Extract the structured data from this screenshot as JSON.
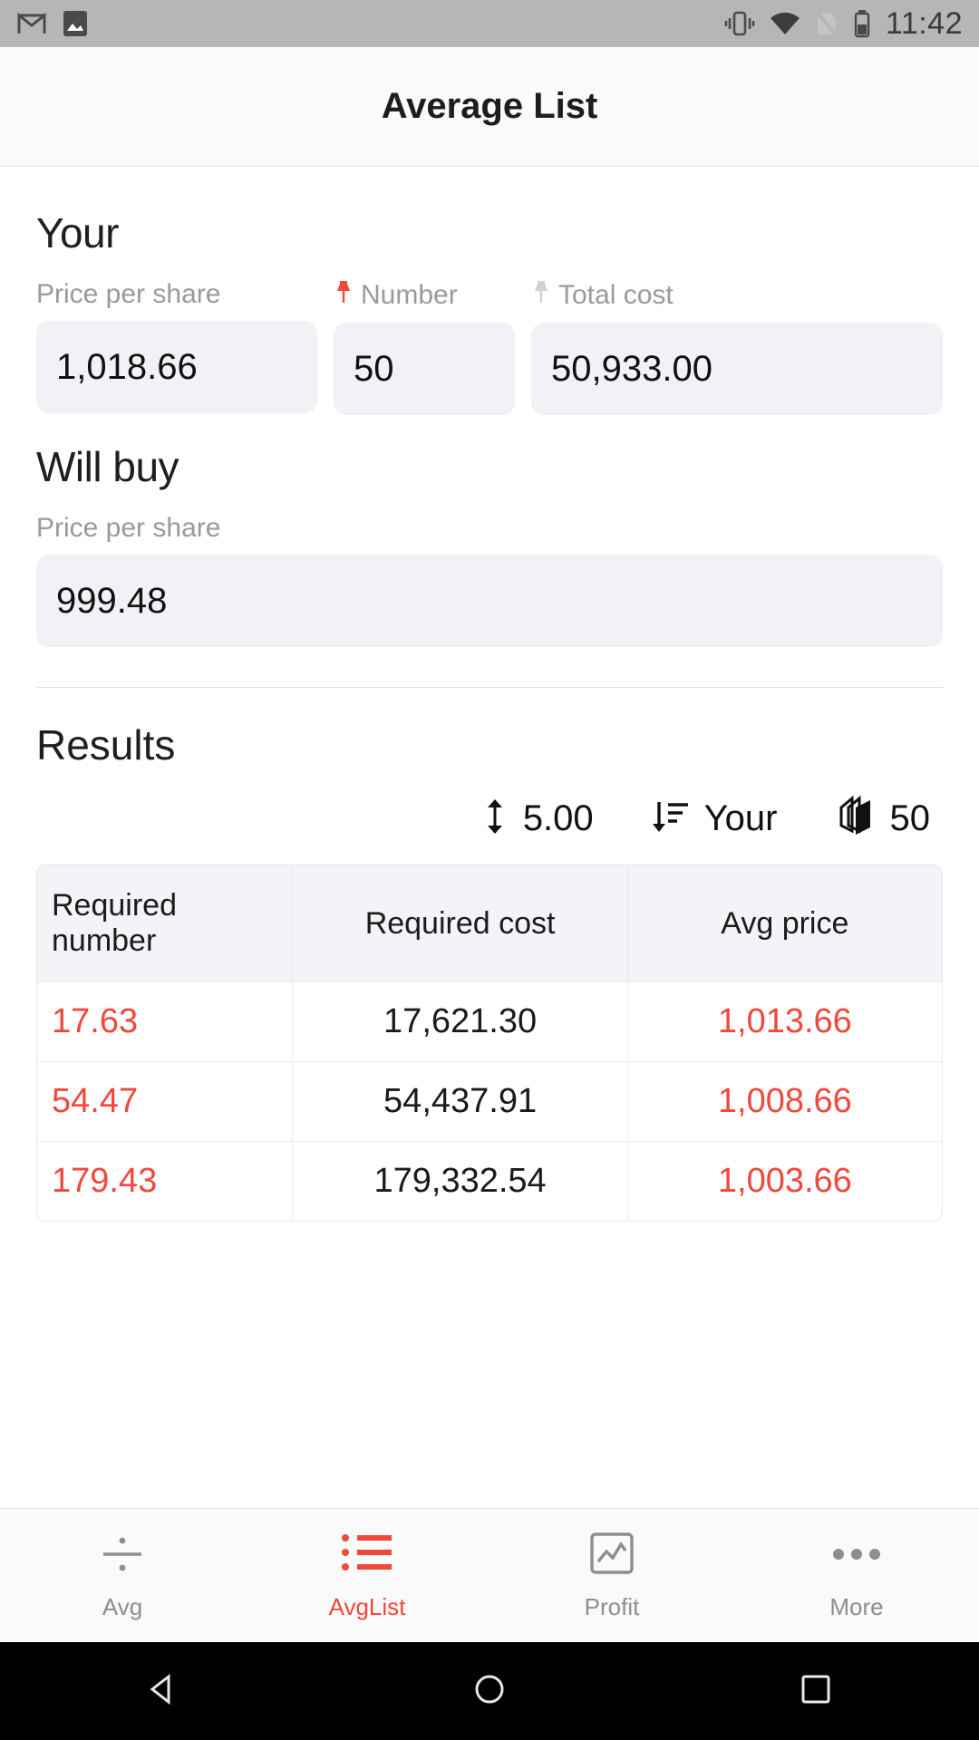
{
  "status_bar": {
    "time": "11:42",
    "left_icons": [
      "gmail-icon",
      "gallery-icon"
    ],
    "right_icons": [
      "vibrate-icon",
      "wifi-icon",
      "sim-missing-icon",
      "battery-icon"
    ]
  },
  "app_bar": {
    "title": "Average List"
  },
  "your_section": {
    "heading": "Your",
    "fields": [
      {
        "label": "Price per share",
        "value": "1,018.66",
        "pin": "none"
      },
      {
        "label": "Number",
        "value": "50",
        "pin": "red"
      },
      {
        "label": "Total cost",
        "value": "50,933.00",
        "pin": "gray"
      }
    ]
  },
  "will_buy_section": {
    "heading": "Will buy",
    "label": "Price per share",
    "value": "999.48"
  },
  "results_section": {
    "heading": "Results",
    "toolbar": [
      {
        "icon": "step-updown-icon",
        "value": "5.00"
      },
      {
        "icon": "sort-descending-icon",
        "value": "Your"
      },
      {
        "icon": "layers-stack-icon",
        "value": "50"
      }
    ],
    "table": {
      "headers": [
        "Required number",
        "Required cost",
        "Avg price"
      ],
      "rows": [
        {
          "required_number": "17.63",
          "required_cost": "17,621.30",
          "avg_price": "1,013.66"
        },
        {
          "required_number": "54.47",
          "required_cost": "54,437.91",
          "avg_price": "1,008.66"
        },
        {
          "required_number": "179.43",
          "required_cost": "179,332.54",
          "avg_price": "1,003.66"
        }
      ]
    }
  },
  "bottom_nav": {
    "items": [
      {
        "label": "Avg",
        "icon": "divide-icon",
        "active": false
      },
      {
        "label": "AvgList",
        "icon": "list-icon",
        "active": true
      },
      {
        "label": "Profit",
        "icon": "chart-box-icon",
        "active": false
      },
      {
        "label": "More",
        "icon": "more-dots-icon",
        "active": false
      }
    ]
  },
  "system_nav": {
    "items": [
      "back-icon",
      "home-icon",
      "recents-icon"
    ]
  },
  "colors": {
    "accent_red": "#f0483c",
    "field_bg": "#f1f1f6",
    "status_bar_bg": "#b6b6b6",
    "app_bar_bg": "#fafafa"
  }
}
